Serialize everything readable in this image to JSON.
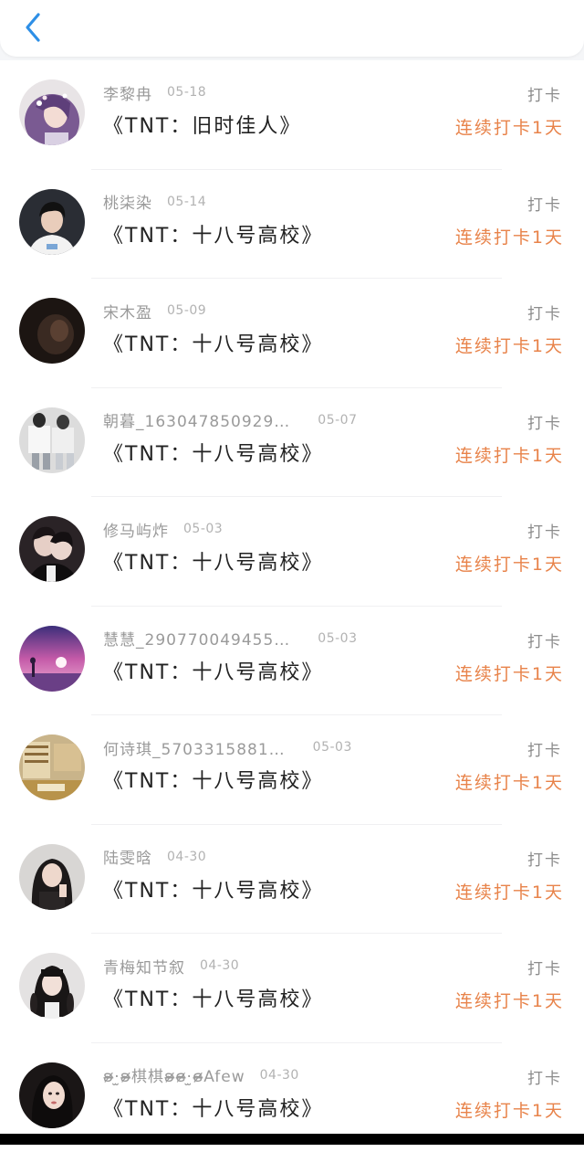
{
  "header": {
    "back_icon": "chevron-left-icon",
    "accent": "#2e8fe6"
  },
  "colors": {
    "streak": "#e8834a",
    "name": "#9a9a9a",
    "title": "#222222"
  },
  "entries": [
    {
      "name": "李黎冉",
      "date": "05-18",
      "book": "《TNT：旧时佳人》",
      "action": "打卡",
      "streak": "连续打卡1天",
      "avatar": "girl-purple-hair-avatar"
    },
    {
      "name": "桃柒染",
      "date": "05-14",
      "book": "《TNT：十八号高校》",
      "action": "打卡",
      "streak": "连续打卡1天",
      "avatar": "boy-white-shirt-avatar"
    },
    {
      "name": "宋木盈",
      "date": "05-09",
      "book": "《TNT：十八号高校》",
      "action": "打卡",
      "streak": "连续打卡1天",
      "avatar": "dark-photo-avatar"
    },
    {
      "name": "朝暮_163047850929…",
      "date": "05-07",
      "book": "《TNT：十八号高校》",
      "action": "打卡",
      "streak": "连续打卡1天",
      "avatar": "couple-white-avatar"
    },
    {
      "name": "修马屿炸",
      "date": "05-03",
      "book": "《TNT：十八号高校》",
      "action": "打卡",
      "streak": "连续打卡1天",
      "avatar": "couple-embrace-avatar"
    },
    {
      "name": "慧慧_290770049455…",
      "date": "05-03",
      "book": "《TNT：十八号高校》",
      "action": "打卡",
      "streak": "连续打卡1天",
      "avatar": "purple-sunset-avatar"
    },
    {
      "name": "何诗琪_5703315881…",
      "date": "05-03",
      "book": "《TNT：十八号高校》",
      "action": "打卡",
      "streak": "连续打卡1天",
      "avatar": "library-avatar"
    },
    {
      "name": "陆雯晗",
      "date": "04-30",
      "book": "《TNT：十八号高校》",
      "action": "打卡",
      "streak": "连续打卡1天",
      "avatar": "girl-dark-hair-avatar"
    },
    {
      "name": "青梅知节叙",
      "date": "04-30",
      "book": "《TNT：十八号高校》",
      "action": "打卡",
      "streak": "连续打卡1天",
      "avatar": "girl-braids-avatar"
    },
    {
      "name": "ʚ̴̶̷̷·̫ʚ̴̶̷̷棋棋ʚ̴̶̷̷ɞ̴̶̷·̫ɞ̴̶̷̷Afew",
      "date": "04-30",
      "book": "《TNT：十八号高校》",
      "action": "打卡",
      "streak": "连续打卡1天",
      "avatar": "girl-portrait-avatar"
    }
  ]
}
